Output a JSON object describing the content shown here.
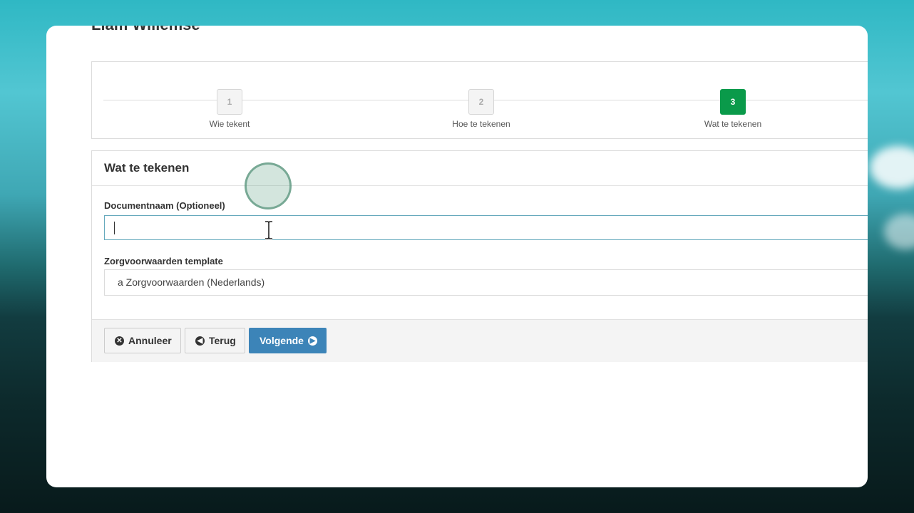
{
  "page_title": "Liam Willemse",
  "steps": [
    {
      "number": "1",
      "label": "Wie tekent",
      "active": false
    },
    {
      "number": "2",
      "label": "Hoe te tekenen",
      "active": false
    },
    {
      "number": "3",
      "label": "Wat te tekenen",
      "active": true
    }
  ],
  "panel": {
    "heading": "Wat te tekenen",
    "document_name_label": "Documentnaam (Optioneel)",
    "document_name_value": "",
    "template_label": "Zorgvoorwaarden template",
    "template_selected": "a Zorgvoorwaarden (Nederlands)"
  },
  "buttons": {
    "cancel": "Annuleer",
    "back": "Terug",
    "next": "Volgende"
  },
  "icons": {
    "cancel": "times-circle-icon",
    "back": "arrow-circle-left-icon",
    "next": "arrow-circle-right-icon"
  },
  "colors": {
    "active_step": "#0a9a4a",
    "primary_button": "#3c84b8",
    "input_focus_border": "#66aabd"
  }
}
